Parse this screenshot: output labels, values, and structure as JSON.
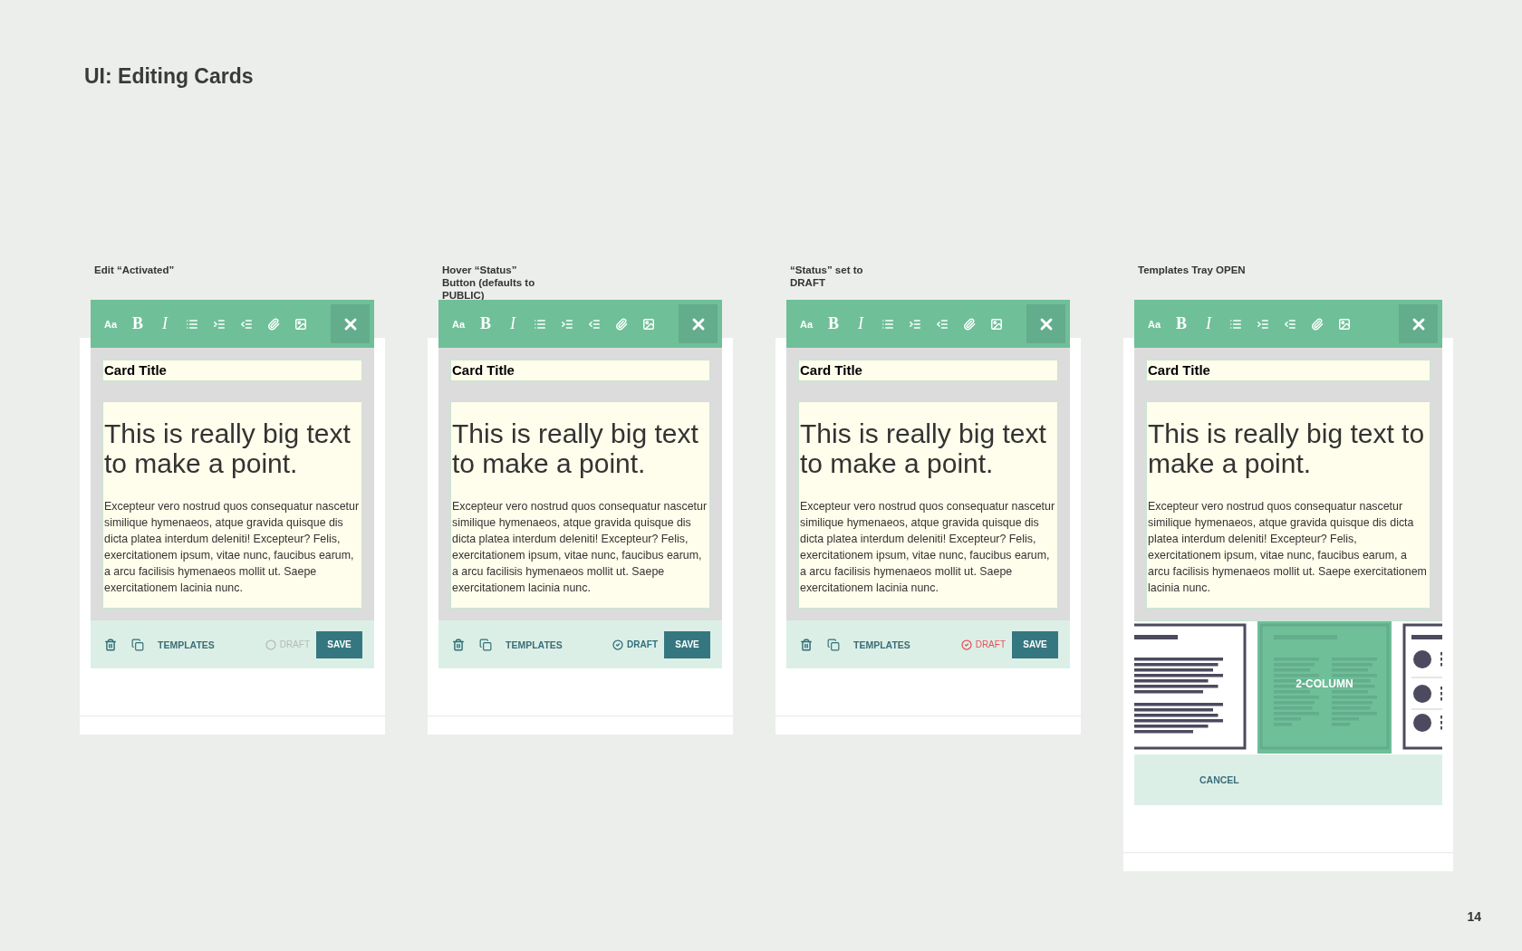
{
  "title": "UI: Editing Cards",
  "page_number": "14",
  "panels": [
    {
      "caption": "Edit “Activated”",
      "editor": {
        "toolbar": [
          {
            "kind": "font-size",
            "label": "Aa"
          },
          {
            "kind": "bold",
            "label": "B"
          },
          {
            "kind": "italic",
            "label": "I"
          },
          {
            "kind": "bullets"
          },
          {
            "kind": "indent"
          },
          {
            "kind": "outdent"
          },
          {
            "kind": "attach"
          },
          {
            "kind": "image"
          }
        ],
        "card_title": "Card Title",
        "headline": "This is really big text to make a point.",
        "body": "Excepteur vero nostrud quos consequatur nascetur similique hymenaeos, atque gravida quisque dis dicta platea interdum deleniti! Excepteur? Felis, exercitationem ipsum, vitae nunc, faucibus earum, a arcu facilisis hymenaeos mollit ut. Saepe exercitationem lacinia nunc.",
        "footer": {
          "templates_label": "TEMPLATES",
          "status": {
            "label": "DRAFT",
            "hovered": false,
            "draft": false
          },
          "save_label": "SAVE"
        }
      }
    },
    {
      "caption": "Hover “Status” Button (defaults to PUBLIC)",
      "editor": {
        "toolbar": [
          {
            "kind": "font-size",
            "label": "Aa"
          },
          {
            "kind": "bold",
            "label": "B"
          },
          {
            "kind": "italic",
            "label": "I"
          },
          {
            "kind": "bullets"
          },
          {
            "kind": "indent"
          },
          {
            "kind": "outdent"
          },
          {
            "kind": "attach"
          },
          {
            "kind": "image"
          }
        ],
        "card_title": "Card Title",
        "headline": "This is really big text to make a point.",
        "body": "Excepteur vero nostrud quos consequatur nascetur similique hymenaeos, atque gravida quisque dis dicta platea interdum deleniti! Excepteur? Felis, exercitationem ipsum, vitae nunc, faucibus earum, a arcu facilisis hymenaeos mollit ut. Saepe exercitationem lacinia nunc.",
        "footer": {
          "templates_label": "TEMPLATES",
          "status": {
            "label": "DRAFT",
            "hovered": true,
            "draft": false
          },
          "save_label": "SAVE"
        }
      }
    },
    {
      "caption": "“Status” set to DRAFT",
      "editor": {
        "toolbar": [
          {
            "kind": "font-size",
            "label": "Aa"
          },
          {
            "kind": "bold",
            "label": "B"
          },
          {
            "kind": "italic",
            "label": "I"
          },
          {
            "kind": "bullets"
          },
          {
            "kind": "indent"
          },
          {
            "kind": "outdent"
          },
          {
            "kind": "attach"
          },
          {
            "kind": "image"
          }
        ],
        "card_title": "Card Title",
        "headline": "This is really big text to make a point.",
        "body": "Excepteur vero nostrud quos consequatur nascetur similique hymenaeos, atque gravida quisque dis dicta platea interdum deleniti! Excepteur? Felis, exercitationem ipsum, vitae nunc, faucibus earum, a arcu facilisis hymenaeos mollit ut. Saepe exercitationem lacinia nunc.",
        "footer": {
          "templates_label": "TEMPLATES",
          "status": {
            "label": "DRAFT",
            "hovered": false,
            "draft": true
          },
          "save_label": "SAVE"
        }
      }
    },
    {
      "caption": "Templates Tray OPEN",
      "editor": {
        "toolbar": [
          {
            "kind": "font-size",
            "label": "Aa"
          },
          {
            "kind": "bold",
            "label": "B"
          },
          {
            "kind": "italic",
            "label": "I"
          },
          {
            "kind": "bullets"
          },
          {
            "kind": "indent"
          },
          {
            "kind": "outdent"
          },
          {
            "kind": "attach"
          },
          {
            "kind": "image"
          }
        ],
        "card_title": "Card Title",
        "headline": "This is really big text to make a point.",
        "body": "Excepteur vero nostrud quos consequatur nascetur similique hymenaeos, atque gravida quisque dis dicta platea interdum deleniti! Excepteur? Felis, exercitationem ipsum, vitae nunc, faucibus earum, a arcu facilisis hymenaeos mollit ut. Saepe exercitationem lacinia nunc.",
        "tray": {
          "templates": [
            {
              "kind": "single-column",
              "selected": false
            },
            {
              "kind": "two-column",
              "label": "2-COLUMN",
              "selected": true
            },
            {
              "kind": "list",
              "selected": false
            }
          ],
          "cancel_label": "CANCEL"
        }
      }
    }
  ]
}
